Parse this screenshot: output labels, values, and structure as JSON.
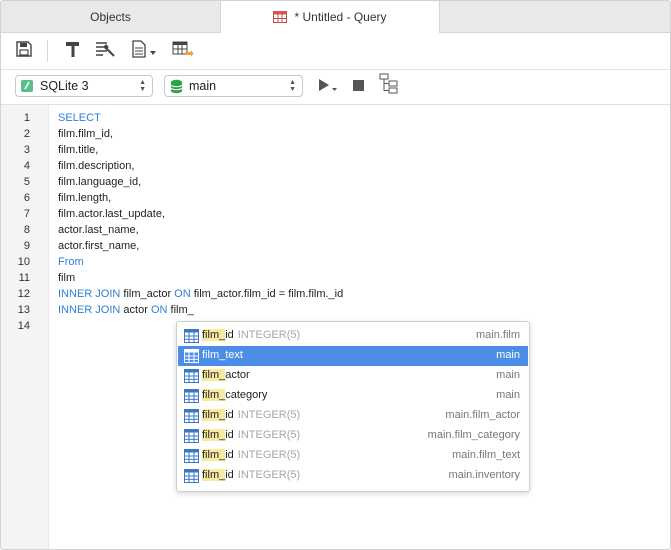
{
  "tabs": {
    "objects_label": "Objects",
    "query_label": "* Untitled - Query"
  },
  "toolbar": {
    "icons": [
      "save-icon",
      "build-icon",
      "format-icon",
      "code-snippet-icon",
      "export-table-icon"
    ]
  },
  "connection": {
    "driver": "SQLite 3",
    "database": "main"
  },
  "editor": {
    "line_numbers": [
      "1",
      "2",
      "3",
      "4",
      "5",
      "6",
      "7",
      "8",
      "9",
      "10",
      "11",
      "12",
      "13",
      "14"
    ],
    "lines": [
      "SELECT",
      "film.film_id,",
      "film.title,",
      "film.description,",
      "film.language_id,",
      "film.length,",
      "film.actor.last_update,",
      "actor.last_name,",
      "actor.first_name,",
      "From",
      "film",
      "INNER JOIN film_actor ON film_actor.film_id = film.film._id",
      "INNER JOIN actor ON film_",
      ""
    ]
  },
  "autocomplete": {
    "items": [
      {
        "prefix": "film_",
        "rest": "id",
        "type": "INTEGER(5)",
        "source": "main.film",
        "selected": false
      },
      {
        "prefix": "film_",
        "rest": "text",
        "type": "",
        "source": "main",
        "selected": true
      },
      {
        "prefix": "film_",
        "rest": "actor",
        "type": "",
        "source": "main",
        "selected": false
      },
      {
        "prefix": "film_",
        "rest": "category",
        "type": "",
        "source": "main",
        "selected": false
      },
      {
        "prefix": "film_",
        "rest": "id",
        "type": "INTEGER(5)",
        "source": "main.film_actor",
        "selected": false
      },
      {
        "prefix": "film_",
        "rest": "id",
        "type": "INTEGER(5)",
        "source": "main.film_category",
        "selected": false
      },
      {
        "prefix": "film_",
        "rest": "id",
        "type": "INTEGER(5)",
        "source": "main.film_text",
        "selected": false
      },
      {
        "prefix": "film_",
        "rest": "id",
        "type": "INTEGER(5)",
        "source": "main.inventory",
        "selected": false
      }
    ]
  },
  "colors": {
    "keyword": "#2e7fd3",
    "selection": "#4c8ee7",
    "match_highlight": "#f7e9a0",
    "gutter_bg": "#f4f4f4"
  }
}
